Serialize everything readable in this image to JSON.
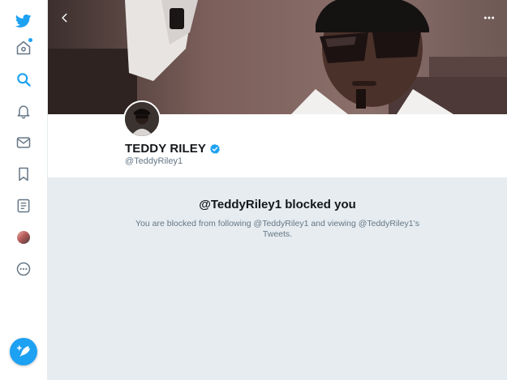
{
  "sidebar": {
    "items": [
      {
        "name": "home"
      },
      {
        "name": "explore"
      },
      {
        "name": "notifications"
      },
      {
        "name": "messages"
      },
      {
        "name": "bookmarks"
      },
      {
        "name": "lists"
      },
      {
        "name": "profile"
      },
      {
        "name": "more"
      }
    ],
    "accent_color": "#1da1f2"
  },
  "profile": {
    "display_name": "TEDDY RILEY",
    "handle": "@TeddyRiley1",
    "verified": true
  },
  "blocked": {
    "title": "@TeddyRiley1 blocked you",
    "description": "You are blocked from following @TeddyRiley1 and viewing @TeddyRiley1’s Tweets."
  }
}
